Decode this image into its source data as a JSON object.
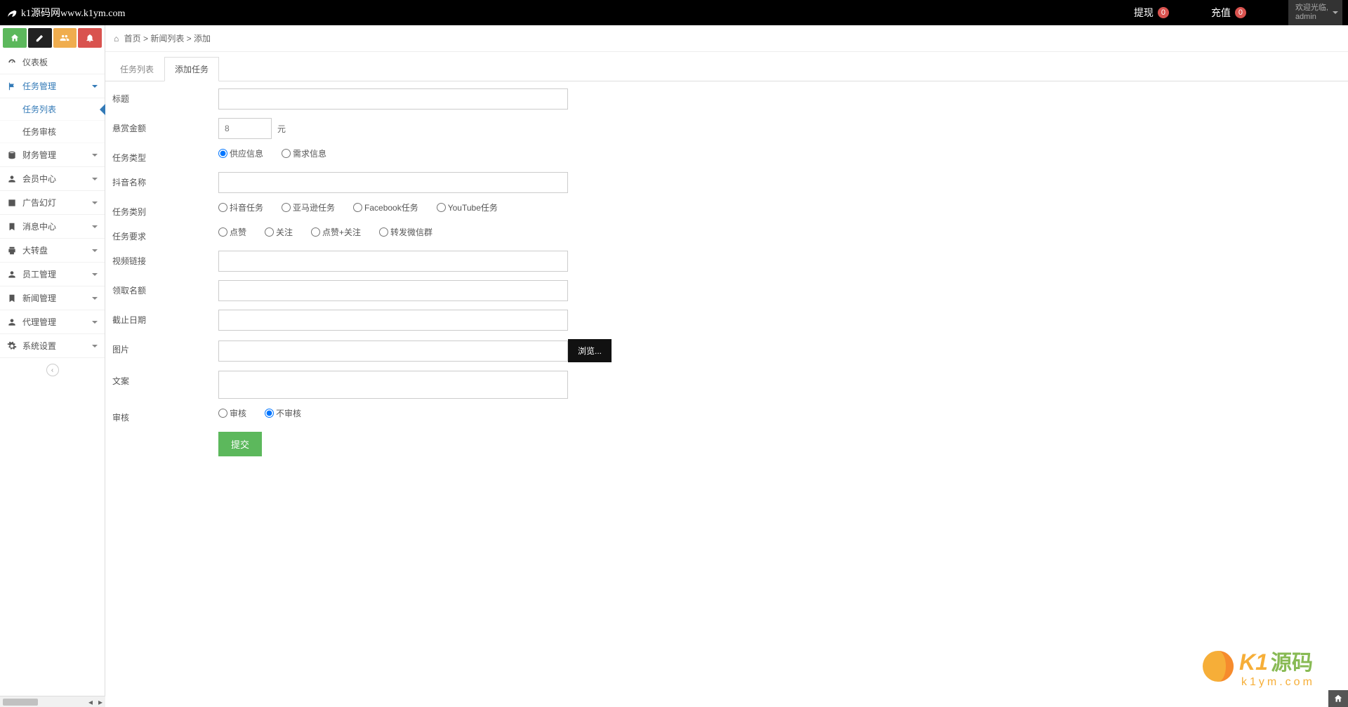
{
  "topbar": {
    "brand": "k1源码网www.k1ym.com",
    "withdraw_label": "提现",
    "withdraw_count": "0",
    "recharge_label": "充值",
    "recharge_count": "0",
    "welcome": "欢迎光临,",
    "username": "admin"
  },
  "sidebar": {
    "dashboard": "仪表板",
    "task_mgmt": "任务管理",
    "task_list": "任务列表",
    "task_audit": "任务审核",
    "finance": "财务管理",
    "member": "会员中心",
    "adslide": "广告幻灯",
    "msg": "消息中心",
    "wheel": "大转盘",
    "staff": "员工管理",
    "news": "新闻管理",
    "agent": "代理管理",
    "system": "系统设置"
  },
  "crumb": {
    "home": "首页",
    "sep": ">",
    "mid": "新闻列表",
    "last": "添加"
  },
  "tabs": {
    "list": "任务列表",
    "add": "添加任务"
  },
  "form": {
    "title_lbl": "标题",
    "reward_lbl": "悬赏金额",
    "reward_placeholder": "8",
    "reward_unit": "元",
    "type_lbl": "任务类型",
    "type_supply": "供应信息",
    "type_demand": "需求信息",
    "douyin_name_lbl": "抖音名称",
    "category_lbl": "任务类别",
    "cat_douyin": "抖音任务",
    "cat_amazon": "亚马逊任务",
    "cat_facebook": "Facebook任务",
    "cat_youtube": "YouTube任务",
    "require_lbl": "任务要求",
    "req_like": "点赞",
    "req_follow": "关注",
    "req_likefollow": "点赞+关注",
    "req_forward": "转发微信群",
    "video_lbl": "视频链接",
    "quota_lbl": "领取名额",
    "deadline_lbl": "截止日期",
    "image_lbl": "图片",
    "browse": "浏览...",
    "copy_lbl": "文案",
    "audit_lbl": "审核",
    "audit_yes": "审核",
    "audit_no": "不审核",
    "submit": "提交"
  },
  "watermark": {
    "k1": "K1",
    "cn": "源码",
    "url": "k1ym.com"
  }
}
